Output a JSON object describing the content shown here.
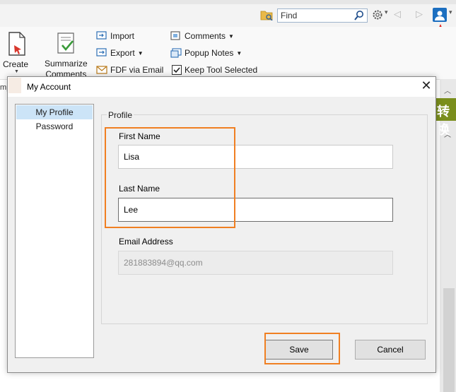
{
  "toolbar": {
    "find_placeholder": "Find"
  },
  "ribbon": {
    "create_label": "Create",
    "summarize_label_line1": "Summarize",
    "summarize_label_line2": "Comments",
    "import_label": "Import",
    "export_label": "Export",
    "fdf_label": "FDF via Email",
    "comments_label": "Comments",
    "popup_notes_label": "Popup Notes",
    "keep_tool_label": "Keep Tool Selected"
  },
  "background": {
    "left_edge_text": "mp",
    "right_panel_text": "转换"
  },
  "dialog": {
    "title": "My Account",
    "close_glyph": "✕",
    "nav_items": [
      {
        "label": "My Profile",
        "selected": true
      },
      {
        "label": "Password",
        "selected": false
      }
    ],
    "group_title": "Profile",
    "first_name_label": "First Name",
    "first_name_value": "Lisa",
    "last_name_label": "Last Name",
    "last_name_value": "Lee",
    "email_label": "Email Address",
    "email_value": "281883894@qq.com",
    "save_label": "Save",
    "cancel_label": "Cancel"
  },
  "colors": {
    "highlight": "#f07f22",
    "selection": "#cce4f7",
    "annotation_arrow": "#e0201a"
  }
}
